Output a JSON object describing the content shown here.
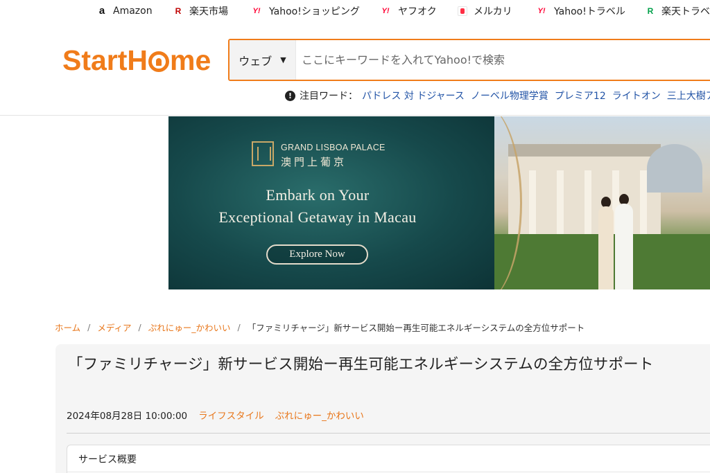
{
  "shortcuts": [
    {
      "label": "Amazon",
      "icon": "amazon-icon",
      "glyph": "a"
    },
    {
      "label": "楽天市場",
      "icon": "rakuten-icon",
      "glyph": "R"
    },
    {
      "label": "Yahoo!ショッピング",
      "icon": "yahoo-icon",
      "glyph": "Y!"
    },
    {
      "label": "ヤフオク",
      "icon": "yahoo-icon",
      "glyph": "Y!"
    },
    {
      "label": "メルカリ",
      "icon": "mercari-icon",
      "glyph": ""
    },
    {
      "label": "Yahoo!トラベル",
      "icon": "yahoo-icon",
      "glyph": "Y!"
    },
    {
      "label": "楽天トラベル",
      "icon": "rakuten-travel-icon",
      "glyph": "R"
    }
  ],
  "header": {
    "logo_text_a": "StartH",
    "logo_text_b": "me",
    "search": {
      "scope_label": "ウェブ",
      "placeholder": "ここにキーワードを入れてYahoo!で検索",
      "value": ""
    }
  },
  "trending": {
    "label": "注目ワード：",
    "words": [
      "パドレス 対 ドジャース",
      "ノーベル物理学賞",
      "プレミア12",
      "ライトオン",
      "三上大樹アナ"
    ]
  },
  "ad": {
    "brand_name": "GRAND LISBOA PALACE",
    "brand_cn": "澳門上葡京",
    "headline_line1": "Embark on Your",
    "headline_line2": "Exceptional Getaway in Macau",
    "cta_label": "Explore Now"
  },
  "breadcrumb": {
    "items": [
      "ホーム",
      "メディア",
      "ぷれにゅー_かわいい"
    ],
    "current": "「ファミリチャージ」新サービス開始ー再生可能エネルギーシステムの全方位サポート"
  },
  "article": {
    "title": "「ファミリチャージ」新サービス開始ー再生可能エネルギーシステムの全方位サポート",
    "date": "2024年08月28日 10:00:00",
    "category": "ライフスタイル",
    "author": "ぷれにゅー_かわいい",
    "toc_title": "サービス概要"
  },
  "colors": {
    "accent": "#f07c1a",
    "link": "#2153a6",
    "rakuten": "#bf0000",
    "yahoo": "#ff0033"
  }
}
